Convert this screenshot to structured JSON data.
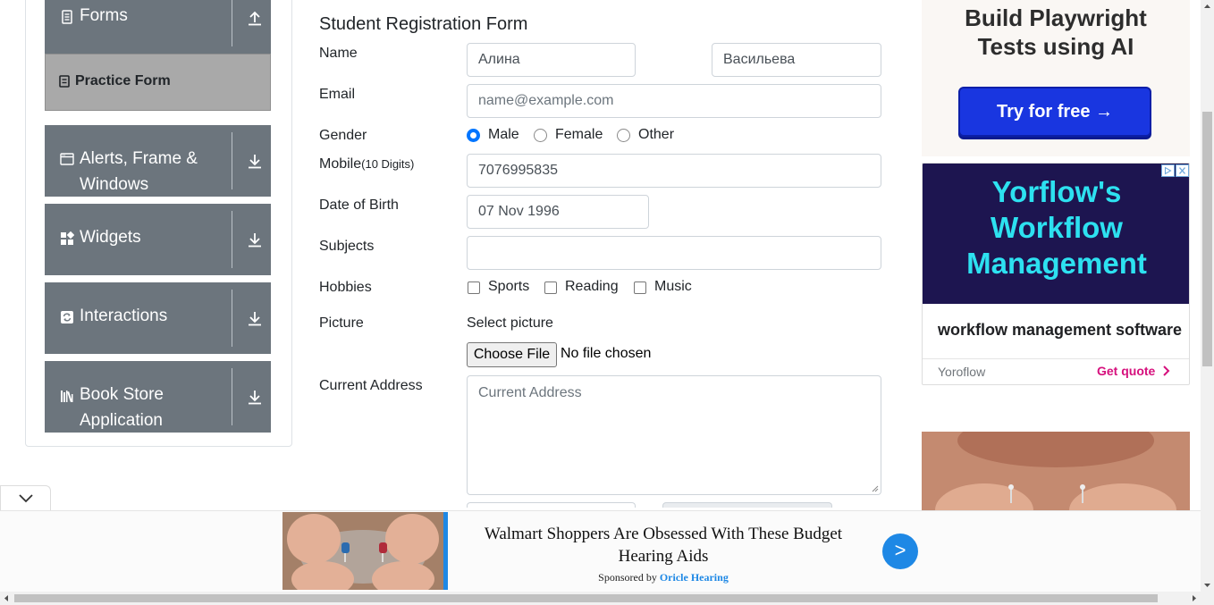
{
  "sidebar": {
    "groups": [
      {
        "label": "Forms",
        "icon": "document-icon",
        "arrow": "arrow-up-icon"
      },
      {
        "label": "Alerts, Frame & Windows",
        "icon": "window-icon",
        "arrow": "download-arrow-icon"
      },
      {
        "label": "Widgets",
        "icon": "widgets-icon",
        "arrow": "download-arrow-icon"
      },
      {
        "label": "Interactions",
        "icon": "interactions-icon",
        "arrow": "download-arrow-icon"
      },
      {
        "label": "Book Store Application",
        "icon": "books-icon",
        "arrow": "download-arrow-icon"
      }
    ],
    "active_item": {
      "label": "Practice Form",
      "icon": "form-icon"
    }
  },
  "form": {
    "title": "Student Registration Form",
    "labels": {
      "name": "Name",
      "email": "Email",
      "gender": "Gender",
      "mobile": "Mobile",
      "mobile_hint": "(10 Digits)",
      "dob": "Date of Birth",
      "subjects": "Subjects",
      "hobbies": "Hobbies",
      "picture": "Picture",
      "address": "Current Address"
    },
    "first_name": "Алина",
    "last_name": "Васильева",
    "email_placeholder": "name@example.com",
    "gender_options": [
      "Male",
      "Female",
      "Other"
    ],
    "gender_selected": "Male",
    "mobile": "7076995835",
    "dob": "07 Nov 1996",
    "subjects": "",
    "hobbies": [
      "Sports",
      "Reading",
      "Music"
    ],
    "picture_prompt": "Select picture",
    "file_button": "Choose File",
    "file_status": "No file chosen",
    "address_placeholder": "Current Address"
  },
  "ads": {
    "playwright": {
      "headline": "Build Playwright Tests using AI",
      "cta": "Try for free →"
    },
    "yoroflow": {
      "headline": "Yorflow's Workflow Management",
      "description": "workflow management software",
      "brand": "Yoroflow",
      "cta": "Get quote"
    },
    "bottom": {
      "headline": "Walmart Shoppers Are Obsessed With These Budget Hearing Aids",
      "sponsor_prefix": "Sponsored by",
      "sponsor_name": "Oricle Hearing",
      "go": ">"
    }
  },
  "colors": {
    "menu_bg": "#6c757d",
    "active_bg": "#a9a9a9",
    "radio_accent": "#0075ff",
    "cta_blue": "#1936e0",
    "ad_cyan": "#2de1f0",
    "ad_navy": "#1d1550",
    "quote_pink": "#d6107d",
    "sponsor_blue": "#1e88e5"
  }
}
